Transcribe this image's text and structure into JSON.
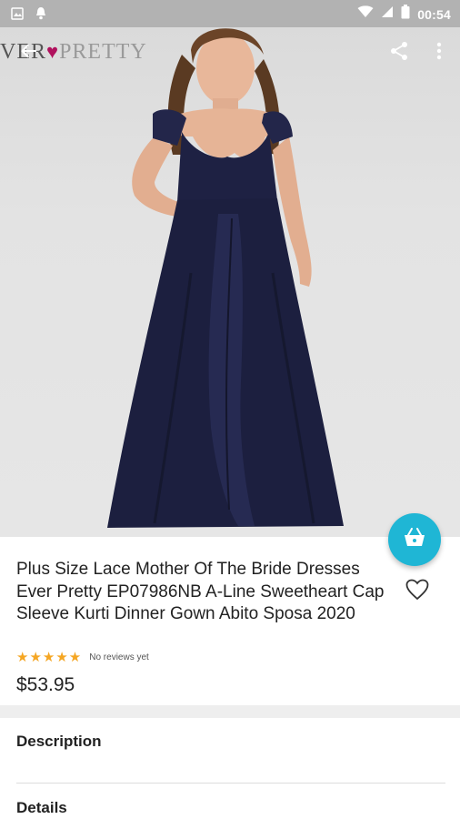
{
  "status_bar": {
    "time": "00:54",
    "left_icons": [
      "image-icon",
      "notification-bell-icon"
    ],
    "right_icons": [
      "wifi-icon",
      "cellular-signal-icon",
      "battery-icon"
    ]
  },
  "hero": {
    "brand_prefix": "VER",
    "brand_suffix": "PRETTY",
    "icons": [
      "back-arrow-icon",
      "share-icon",
      "more-vert-icon"
    ]
  },
  "product": {
    "title": "Plus Size Lace Mother Of The Bride Dresses Ever Pretty EP07986NB A-Line Sweetheart Cap Sleeve Kurti Dinner Gown Abito Sposa 2020",
    "stars": "★★★★★",
    "reviews": "No reviews yet",
    "price": "$53.95"
  },
  "sections": {
    "description": "Description",
    "details": "Details"
  },
  "colors": {
    "accent": "#1fb6d5",
    "stars": "#f5a623",
    "dress": "#1c1f3f",
    "brand_heart": "#b0115d"
  }
}
